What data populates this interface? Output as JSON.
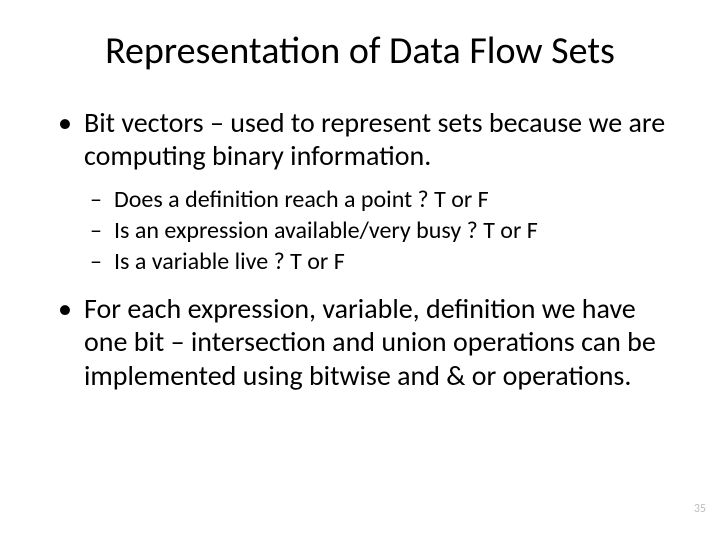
{
  "title": "Representation of Data Flow Sets",
  "bullets": [
    {
      "text": "Bit vectors  – used to represent sets because we are computing binary information.",
      "sub": [
        "Does a definition reach a point ? T or F",
        "Is an expression available/very busy ? T or F",
        "Is a variable live ? T or F"
      ]
    },
    {
      "text": "For each expression, variable, definition  we have one bit – intersection and union operations can be implemented using bitwise and & or operations.",
      "sub": []
    }
  ],
  "page_number": "35"
}
